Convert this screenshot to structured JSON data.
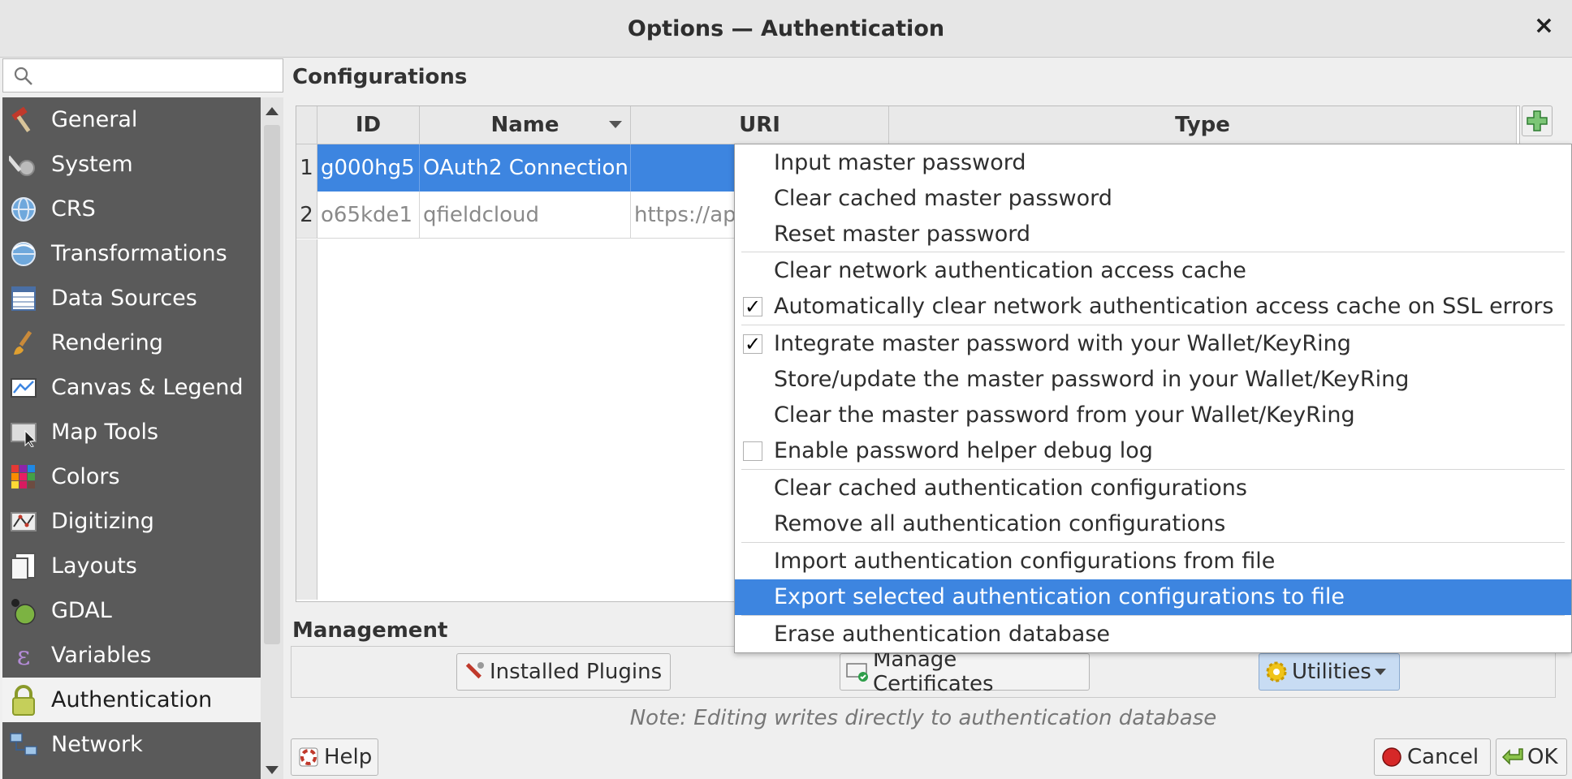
{
  "window": {
    "title": "Options — Authentication",
    "close": "×"
  },
  "search": {
    "placeholder": ""
  },
  "sidebar": {
    "items": [
      {
        "label": "General",
        "icon": "hammer-icon"
      },
      {
        "label": "System",
        "icon": "wrench-gear-icon"
      },
      {
        "label": "CRS",
        "icon": "globe-icon"
      },
      {
        "label": "Transformations",
        "icon": "globe-transform-icon"
      },
      {
        "label": "Data Sources",
        "icon": "table-icon"
      },
      {
        "label": "Rendering",
        "icon": "brush-icon"
      },
      {
        "label": "Canvas & Legend",
        "icon": "map-canvas-icon"
      },
      {
        "label": "Map Tools",
        "icon": "map-tool-icon"
      },
      {
        "label": "Colors",
        "icon": "color-grid-icon"
      },
      {
        "label": "Digitizing",
        "icon": "digitize-icon"
      },
      {
        "label": "Layouts",
        "icon": "layout-icon"
      },
      {
        "label": "GDAL",
        "icon": "gdal-icon"
      },
      {
        "label": "Variables",
        "icon": "epsilon-icon"
      },
      {
        "label": "Authentication",
        "icon": "lock-icon"
      },
      {
        "label": "Network",
        "icon": "network-icon"
      }
    ]
  },
  "configurations": {
    "heading": "Configurations",
    "columns": [
      "ID",
      "Name",
      "URI",
      "Type"
    ],
    "rows": [
      {
        "num": "1",
        "id": "g000hg5",
        "name": "OAuth2 Connection",
        "uri": "",
        "type": ""
      },
      {
        "num": "2",
        "id": "o65kde1",
        "name": "qfieldcloud",
        "uri": "https://ap",
        "type": ""
      }
    ]
  },
  "management": {
    "heading": "Management",
    "installed_plugins": "Installed Plugins",
    "manage_certificates": "Manage Certificates",
    "utilities": "Utilities",
    "note": "Note: Editing writes directly to authentication database"
  },
  "footer": {
    "help": "Help",
    "cancel": "Cancel",
    "ok": "OK"
  },
  "menu": {
    "items": [
      {
        "label": "Input master password",
        "check": null
      },
      {
        "label": "Clear cached master password",
        "check": null
      },
      {
        "label": "Reset master password",
        "check": null
      },
      {
        "label": "Clear network authentication access cache",
        "check": null
      },
      {
        "label": "Automatically clear network authentication access cache on SSL errors",
        "check": true
      },
      {
        "label": "Integrate master password with your Wallet/KeyRing",
        "check": true
      },
      {
        "label": "Store/update the master password in your Wallet/KeyRing",
        "check": null
      },
      {
        "label": "Clear the master password from your Wallet/KeyRing",
        "check": null
      },
      {
        "label": "Enable password helper debug log",
        "check": false
      },
      {
        "label": "Clear cached authentication configurations",
        "check": null
      },
      {
        "label": "Remove all authentication configurations",
        "check": null
      },
      {
        "label": "Import authentication configurations from file",
        "check": null
      },
      {
        "label": "Export selected authentication configurations to file",
        "check": null
      },
      {
        "label": "Erase authentication database",
        "check": null
      }
    ],
    "check_mark": "✓"
  },
  "colors": {
    "selection": "#3d85e0",
    "sidebar": "#5a5a5a"
  }
}
